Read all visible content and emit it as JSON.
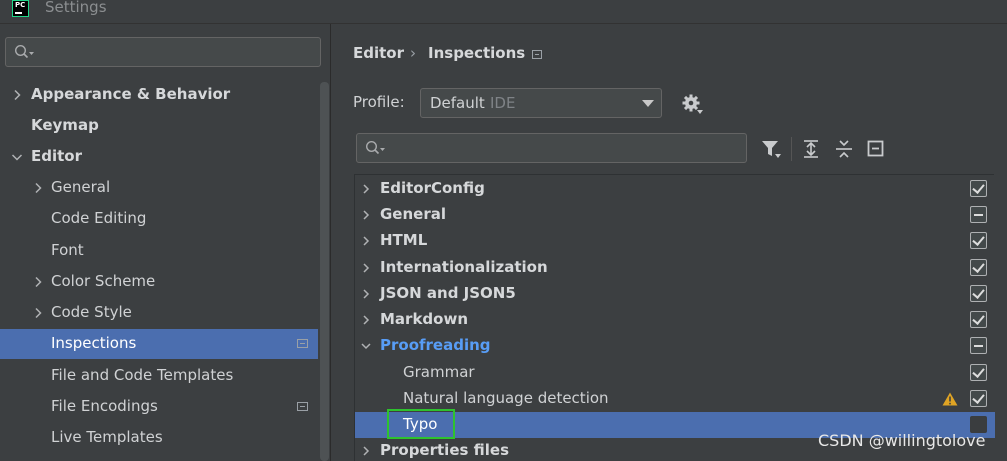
{
  "window": {
    "title": "Settings",
    "logo_text": "PC"
  },
  "sidebar": {
    "search": {
      "placeholder": ""
    },
    "items": [
      {
        "label": "Appearance & Behavior",
        "expandable": true,
        "expanded": false,
        "bold": true
      },
      {
        "label": "Keymap",
        "expandable": false,
        "bold": true
      },
      {
        "label": "Editor",
        "expandable": true,
        "expanded": true,
        "bold": true
      },
      {
        "label": "General",
        "expandable": true,
        "expanded": false
      },
      {
        "label": "Code Editing",
        "expandable": false
      },
      {
        "label": "Font",
        "expandable": false
      },
      {
        "label": "Color Scheme",
        "expandable": true,
        "expanded": false
      },
      {
        "label": "Code Style",
        "expandable": true,
        "expanded": false
      },
      {
        "label": "Inspections",
        "expandable": false,
        "selected": true,
        "badge": true
      },
      {
        "label": "File and Code Templates",
        "expandable": false
      },
      {
        "label": "File Encodings",
        "expandable": false,
        "badge": true
      },
      {
        "label": "Live Templates",
        "expandable": false
      }
    ]
  },
  "breadcrumb": {
    "part1": "Editor",
    "separator": "›",
    "part2": "Inspections"
  },
  "profile": {
    "label": "Profile:",
    "value": "Default",
    "scope": "IDE"
  },
  "inspections": {
    "search": {
      "placeholder": ""
    },
    "rows": [
      {
        "label": "EditorConfig",
        "state": "checked"
      },
      {
        "label": "General",
        "state": "partial"
      },
      {
        "label": "HTML",
        "state": "checked"
      },
      {
        "label": "Internationalization",
        "state": "checked"
      },
      {
        "label": "JSON and JSON5",
        "state": "checked"
      },
      {
        "label": "Markdown",
        "state": "checked"
      },
      {
        "label": "Proofreading",
        "state": "partial",
        "expanded": true
      },
      {
        "label": "Grammar",
        "state": "checked",
        "child": true
      },
      {
        "label": "Natural language detection",
        "state": "checked",
        "child": true,
        "warning": true
      },
      {
        "label": "Typo",
        "state": "unchecked",
        "child": true,
        "selected": true
      },
      {
        "label": "Properties files",
        "state": "checked"
      }
    ]
  },
  "watermark": "CSDN @willingtolove",
  "colors": {
    "selection": "#4b6eaf",
    "accent_link": "#589df6",
    "highlight_box": "#2ec22e",
    "warning": "#e0a424"
  }
}
